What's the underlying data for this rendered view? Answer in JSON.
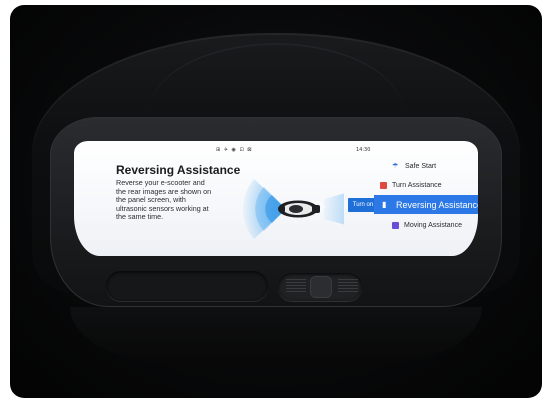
{
  "status_bar": {
    "icons_text": "⊞ ✈ ◉ ⊡ ⊠",
    "time": "14:30"
  },
  "panel": {
    "title": "Reversing Assistance",
    "description": "Reverse your e-scooter and the rear images are shown on the panel screen, with ultrasonic sensors working at the same time.",
    "turn_on_label": "Turn on"
  },
  "menu": {
    "items": [
      {
        "label": "Safe Start",
        "icon": "umbrella-icon",
        "active": false
      },
      {
        "label": "Turn Assistance",
        "icon": "turn-signal-icon",
        "active": false
      },
      {
        "label": "Reversing Assistance",
        "icon": "bars-icon",
        "active": true
      },
      {
        "label": "Moving Assistance",
        "icon": "moving-icon",
        "active": false
      }
    ]
  },
  "colors": {
    "accent": "#2c78e6",
    "turn_on": "#1f6fd8",
    "sensor_wave": "#4aa8f0",
    "turn_icon": "#e04a3c",
    "moving_icon": "#6a4fd6"
  }
}
